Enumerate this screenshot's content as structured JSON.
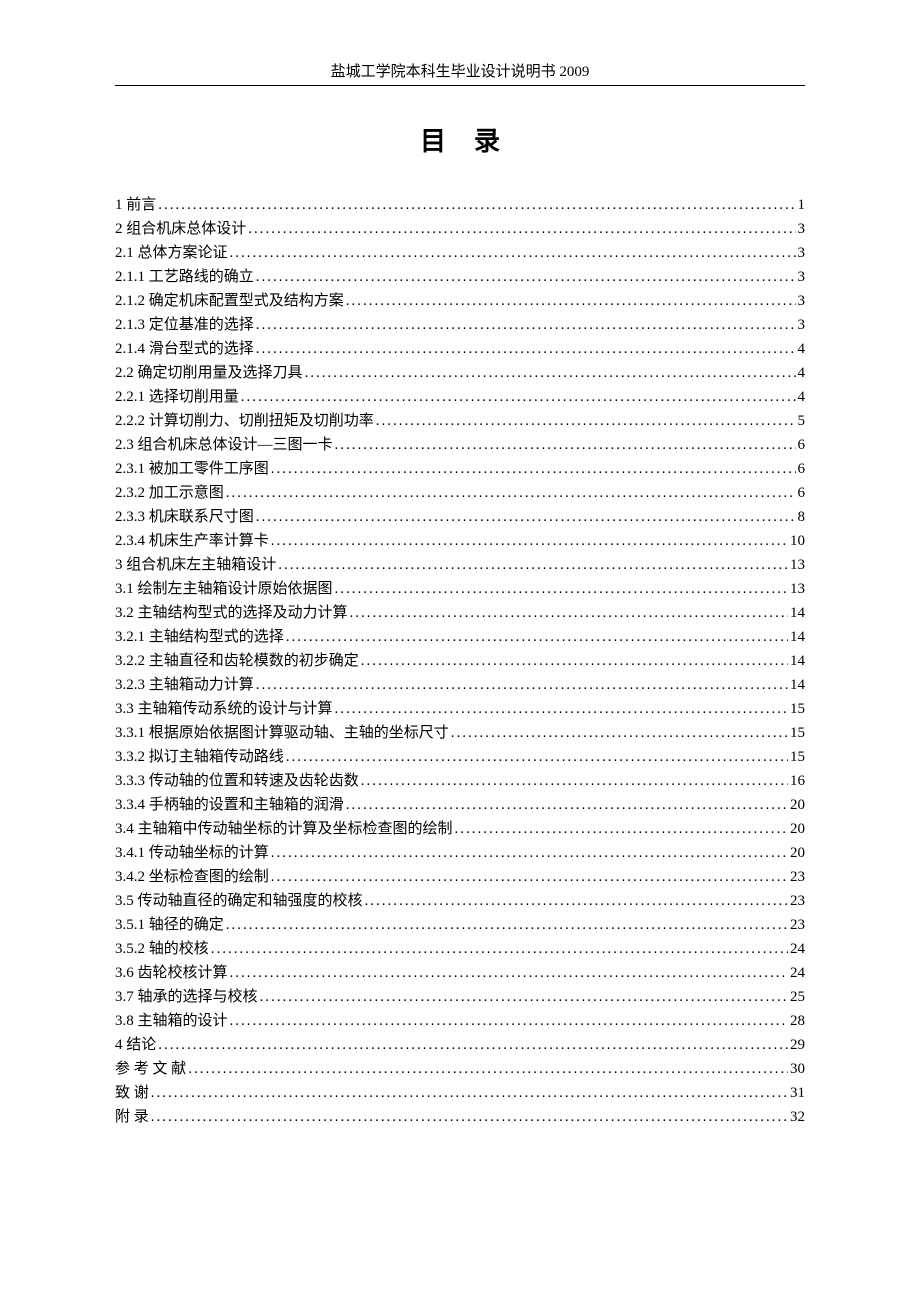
{
  "header": "盐城工学院本科生毕业设计说明书 2009",
  "title": "目录",
  "toc": [
    {
      "label": "1 前言",
      "page": "1"
    },
    {
      "label": "2 组合机床总体设计",
      "page": "3"
    },
    {
      "label": "2.1 总体方案论证",
      "page": "3"
    },
    {
      "label": "2.1.1 工艺路线的确立",
      "page": "3"
    },
    {
      "label": "2.1.2 确定机床配置型式及结构方案",
      "page": "3"
    },
    {
      "label": "2.1.3 定位基准的选择",
      "page": "3"
    },
    {
      "label": "2.1.4 滑台型式的选择",
      "page": "4"
    },
    {
      "label": "2.2 确定切削用量及选择刀具",
      "page": "4"
    },
    {
      "label": "2.2.1 选择切削用量",
      "page": "4"
    },
    {
      "label": "2.2.2 计算切削力、切削扭矩及切削功率",
      "page": "5"
    },
    {
      "label": "2.3 组合机床总体设计—三图一卡",
      "page": "6"
    },
    {
      "label": "2.3.1 被加工零件工序图",
      "page": "6"
    },
    {
      "label": "2.3.2 加工示意图",
      "page": "6"
    },
    {
      "label": "2.3.3 机床联系尺寸图",
      "page": "8"
    },
    {
      "label": "2.3.4 机床生产率计算卡",
      "page": "10"
    },
    {
      "label": "3 组合机床左主轴箱设计",
      "page": "13"
    },
    {
      "label": "3.1 绘制左主轴箱设计原始依据图",
      "page": "13"
    },
    {
      "label": "3.2 主轴结构型式的选择及动力计算",
      "page": "14"
    },
    {
      "label": "3.2.1 主轴结构型式的选择",
      "page": "14"
    },
    {
      "label": "3.2.2 主轴直径和齿轮模数的初步确定",
      "page": "14"
    },
    {
      "label": "3.2.3 主轴箱动力计算",
      "page": "14"
    },
    {
      "label": "3.3 主轴箱传动系统的设计与计算",
      "page": "15"
    },
    {
      "label": "3.3.1 根据原始依据图计算驱动轴、主轴的坐标尺寸",
      "page": "15"
    },
    {
      "label": "3.3.2 拟订主轴箱传动路线",
      "page": "15"
    },
    {
      "label": "3.3.3 传动轴的位置和转速及齿轮齿数",
      "page": "16"
    },
    {
      "label": "3.3.4 手柄轴的设置和主轴箱的润滑",
      "page": "20"
    },
    {
      "label": "3.4 主轴箱中传动轴坐标的计算及坐标检查图的绘制",
      "page": "20"
    },
    {
      "label": "3.4.1 传动轴坐标的计算",
      "page": "20"
    },
    {
      "label": "3.4.2 坐标检查图的绘制",
      "page": "23"
    },
    {
      "label": "3.5 传动轴直径的确定和轴强度的校核",
      "page": "23"
    },
    {
      "label": "3.5.1 轴径的确定",
      "page": "23"
    },
    {
      "label": "3.5.2 轴的校核",
      "page": "24"
    },
    {
      "label": "3.6 齿轮校核计算",
      "page": "24"
    },
    {
      "label": "3.7 轴承的选择与校核",
      "page": "25"
    },
    {
      "label": "3.8 主轴箱的设计",
      "page": "28"
    },
    {
      "label": "4 结论",
      "page": "29"
    },
    {
      "label": "参 考 文 献",
      "page": "30",
      "spaced": true
    },
    {
      "label": "致    谢",
      "page": "31"
    },
    {
      "label": "附    录",
      "page": "32"
    }
  ]
}
